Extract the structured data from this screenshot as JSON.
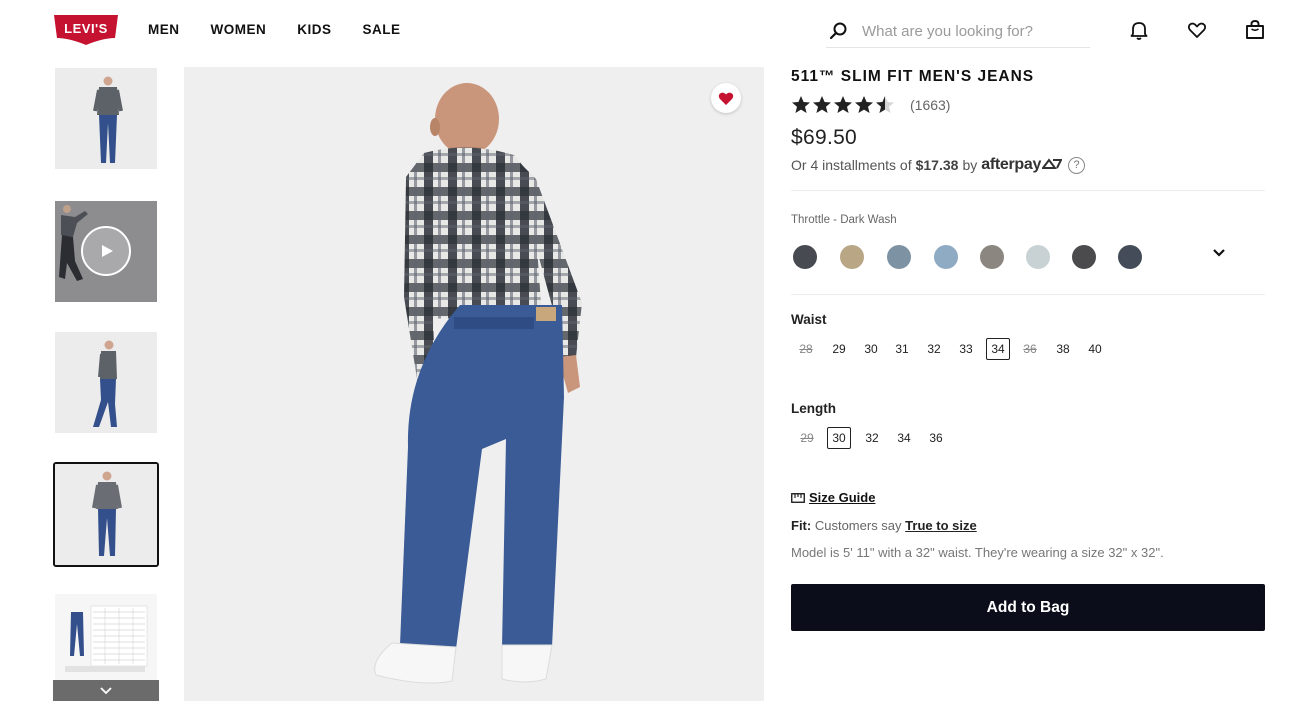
{
  "header": {
    "logo_text": "Levi's",
    "nav": [
      "MEN",
      "WOMEN",
      "KIDS",
      "SALE"
    ],
    "search": {
      "placeholder": "What are you looking for?",
      "value": ""
    },
    "icons": [
      "search-icon",
      "bell-icon",
      "heart-icon",
      "bag-icon"
    ]
  },
  "gallery": {
    "thumbnails": [
      "front-view",
      "video",
      "side-view",
      "back-view",
      "size-chart"
    ],
    "selected_index": 3,
    "video_thumbnail_icon": "play-icon",
    "scroll_icon": "chevron-down-icon",
    "favorite_icon": "heart-icon",
    "brand_red": "#c41230"
  },
  "product": {
    "title": "511™ SLIM FIT MEN'S JEANS",
    "rating": 4.5,
    "rating_count": "(1663)",
    "price": "$69.50",
    "installment_prefix": "Or 4 installments of",
    "installment_amount": "$17.38",
    "installment_by": "by",
    "afterpay": "afterpay",
    "color_name": "Throttle - Dark Wash",
    "swatches": [
      "#474a50",
      "#b8a685",
      "#7d93a3",
      "#8fabc4",
      "#8b8680",
      "#c8d2d4",
      "#4b4b4d",
      "#434c58"
    ],
    "waist_label": "Waist",
    "waist_sizes": [
      {
        "v": "28",
        "na": true
      },
      {
        "v": "29"
      },
      {
        "v": "30"
      },
      {
        "v": "31"
      },
      {
        "v": "32"
      },
      {
        "v": "33"
      },
      {
        "v": "34",
        "sel": true
      },
      {
        "v": "36",
        "na": true
      },
      {
        "v": "38"
      },
      {
        "v": "40"
      }
    ],
    "length_label": "Length",
    "length_sizes": [
      {
        "v": "29",
        "na": true
      },
      {
        "v": "30",
        "sel": true
      },
      {
        "v": "32"
      },
      {
        "v": "34"
      },
      {
        "v": "36"
      }
    ],
    "size_guide": "Size Guide",
    "fit_label": "Fit:",
    "fit_text": "Customers say",
    "fit_link": "True to size",
    "model_text": "Model is 5' 11\" with a 32\" waist. They're wearing a size 32\" x 32\".",
    "add_to_bag": "Add to Bag"
  }
}
